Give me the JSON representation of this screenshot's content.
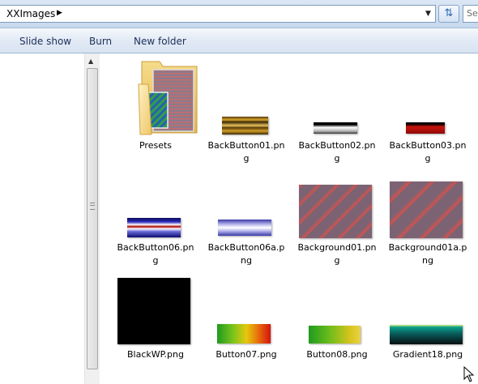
{
  "address": {
    "crumb": "XXImages",
    "search_placeholder": "Se"
  },
  "toolbar": {
    "slideshow": "Slide show",
    "burn": "Burn",
    "new_folder": "New folder"
  },
  "icons": {
    "back_arrow": "chevron-left-icon",
    "crumb_sep": "chevron-right-icon",
    "dropdown": "chevron-down-icon",
    "refresh": "refresh-icon",
    "folder": "folder-icon"
  },
  "items": [
    {
      "line1": "Presets",
      "line2": ""
    },
    {
      "line1": "BackButton01.pn",
      "line2": "g"
    },
    {
      "line1": "BackButton02.pn",
      "line2": "g"
    },
    {
      "line1": "BackButton03.pn",
      "line2": "g"
    },
    {
      "line1": "BackButton06.pn",
      "line2": "g"
    },
    {
      "line1": "BackButton06a.p",
      "line2": "ng"
    },
    {
      "line1": "Background01.pn",
      "line2": "g"
    },
    {
      "line1": "Background01a.p",
      "line2": "ng"
    },
    {
      "line1": "BlackWP.png",
      "line2": ""
    },
    {
      "line1": "Button07.png",
      "line2": ""
    },
    {
      "line1": "Button08.png",
      "line2": ""
    },
    {
      "line1": "Gradient18.png",
      "line2": ""
    }
  ]
}
